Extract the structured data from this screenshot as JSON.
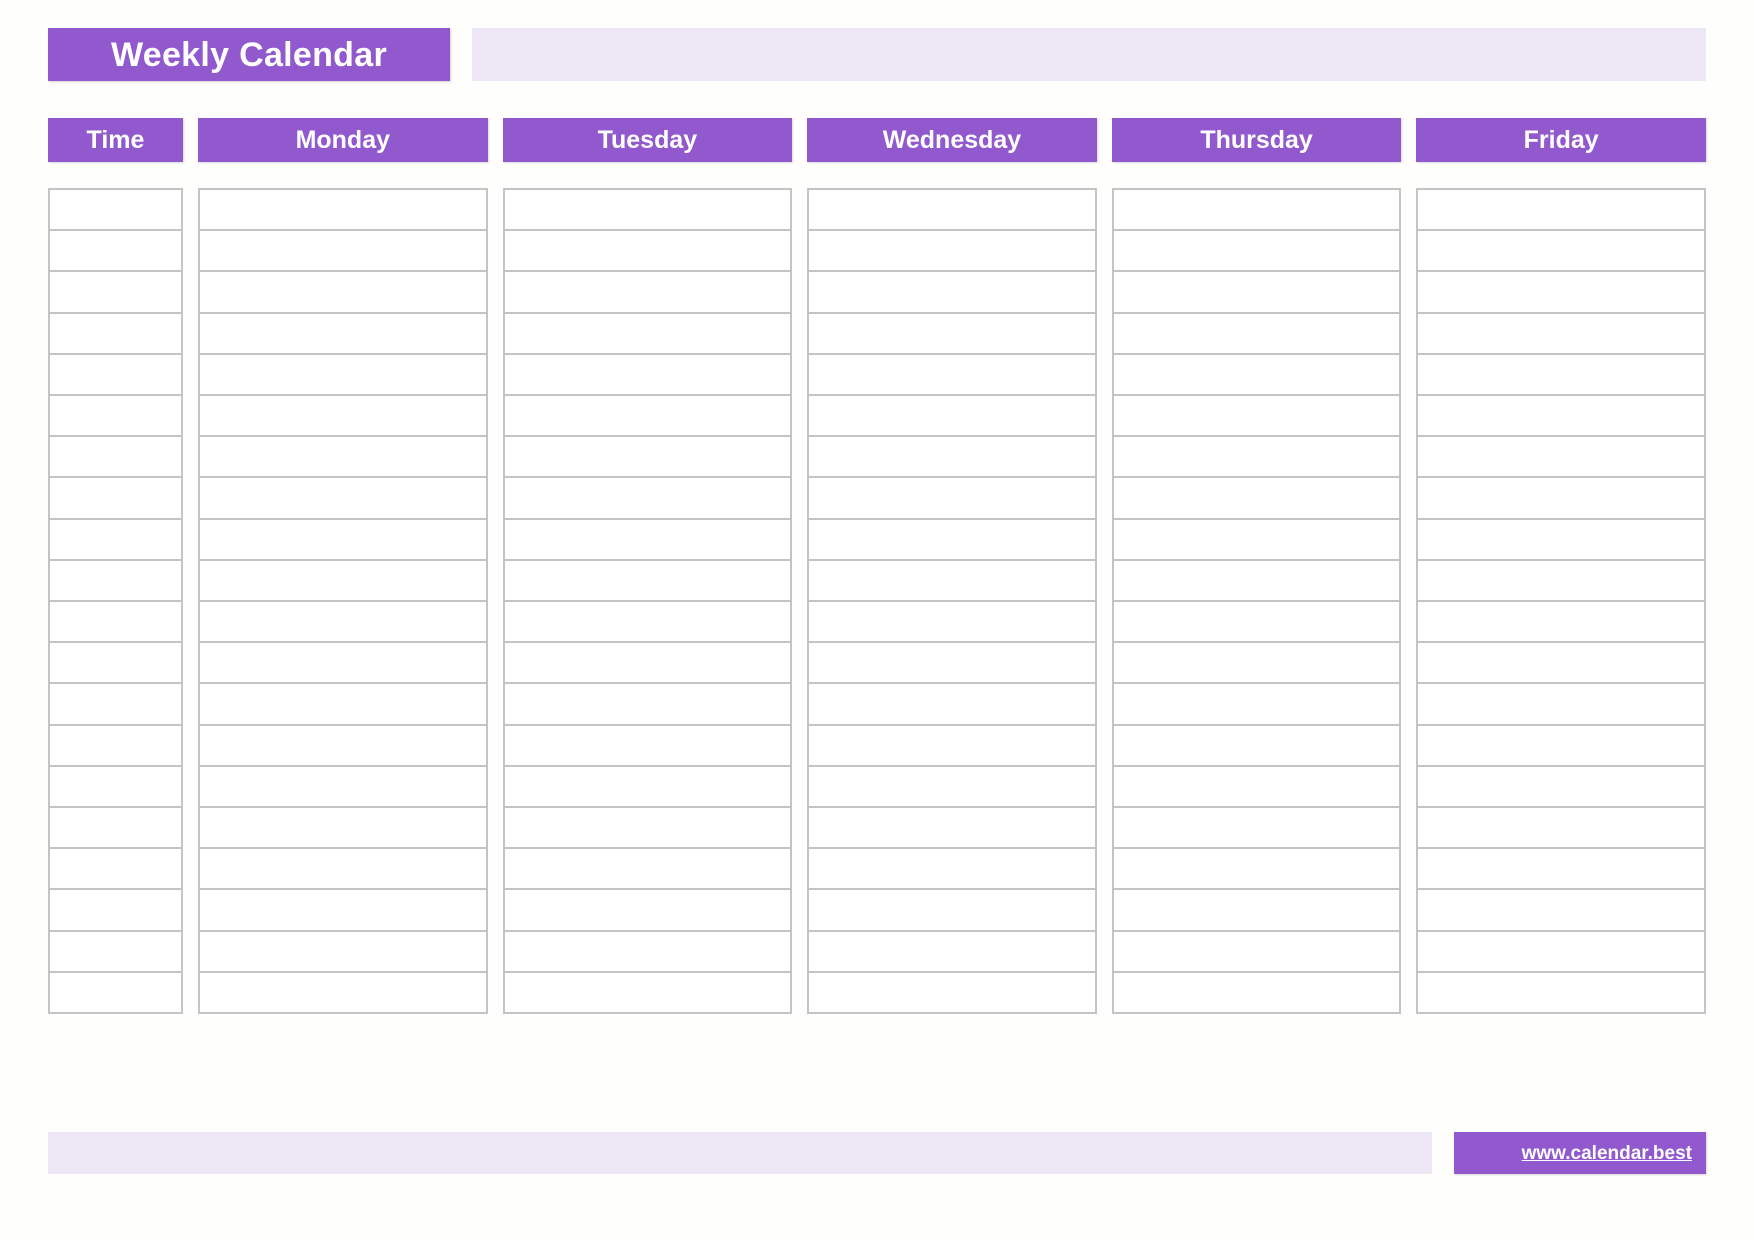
{
  "page": {
    "title": "Weekly Calendar",
    "background_color": "#FEFEFC",
    "accent_color": "#9159CD",
    "tint_color": "#EDE6F5",
    "grid_line_color": "#C4C4C4"
  },
  "header": {
    "title": "Weekly Calendar"
  },
  "table": {
    "columns": [
      {
        "label": "Time",
        "kind": "time"
      },
      {
        "label": "Monday",
        "kind": "day"
      },
      {
        "label": "Tuesday",
        "kind": "day"
      },
      {
        "label": "Wednesday",
        "kind": "day"
      },
      {
        "label": "Thursday",
        "kind": "day"
      },
      {
        "label": "Friday",
        "kind": "day"
      }
    ],
    "row_count": 20,
    "rows": [
      {
        "time": "",
        "monday": "",
        "tuesday": "",
        "wednesday": "",
        "thursday": "",
        "friday": ""
      },
      {
        "time": "",
        "monday": "",
        "tuesday": "",
        "wednesday": "",
        "thursday": "",
        "friday": ""
      },
      {
        "time": "",
        "monday": "",
        "tuesday": "",
        "wednesday": "",
        "thursday": "",
        "friday": ""
      },
      {
        "time": "",
        "monday": "",
        "tuesday": "",
        "wednesday": "",
        "thursday": "",
        "friday": ""
      },
      {
        "time": "",
        "monday": "",
        "tuesday": "",
        "wednesday": "",
        "thursday": "",
        "friday": ""
      },
      {
        "time": "",
        "monday": "",
        "tuesday": "",
        "wednesday": "",
        "thursday": "",
        "friday": ""
      },
      {
        "time": "",
        "monday": "",
        "tuesday": "",
        "wednesday": "",
        "thursday": "",
        "friday": ""
      },
      {
        "time": "",
        "monday": "",
        "tuesday": "",
        "wednesday": "",
        "thursday": "",
        "friday": ""
      },
      {
        "time": "",
        "monday": "",
        "tuesday": "",
        "wednesday": "",
        "thursday": "",
        "friday": ""
      },
      {
        "time": "",
        "monday": "",
        "tuesday": "",
        "wednesday": "",
        "thursday": "",
        "friday": ""
      },
      {
        "time": "",
        "monday": "",
        "tuesday": "",
        "wednesday": "",
        "thursday": "",
        "friday": ""
      },
      {
        "time": "",
        "monday": "",
        "tuesday": "",
        "wednesday": "",
        "thursday": "",
        "friday": ""
      },
      {
        "time": "",
        "monday": "",
        "tuesday": "",
        "wednesday": "",
        "thursday": "",
        "friday": ""
      },
      {
        "time": "",
        "monday": "",
        "tuesday": "",
        "wednesday": "",
        "thursday": "",
        "friday": ""
      },
      {
        "time": "",
        "monday": "",
        "tuesday": "",
        "wednesday": "",
        "thursday": "",
        "friday": ""
      },
      {
        "time": "",
        "monday": "",
        "tuesday": "",
        "wednesday": "",
        "thursday": "",
        "friday": ""
      },
      {
        "time": "",
        "monday": "",
        "tuesday": "",
        "wednesday": "",
        "thursday": "",
        "friday": ""
      },
      {
        "time": "",
        "monday": "",
        "tuesday": "",
        "wednesday": "",
        "thursday": "",
        "friday": ""
      },
      {
        "time": "",
        "monday": "",
        "tuesday": "",
        "wednesday": "",
        "thursday": "",
        "friday": ""
      },
      {
        "time": "",
        "monday": "",
        "tuesday": "",
        "wednesday": "",
        "thursday": "",
        "friday": ""
      }
    ]
  },
  "footer": {
    "url_label": "www.calendar.best"
  }
}
